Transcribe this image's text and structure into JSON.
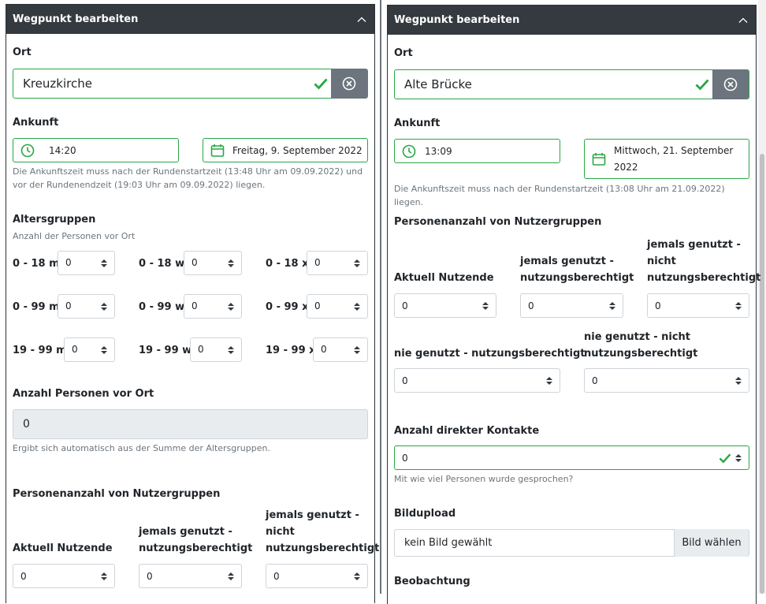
{
  "left": {
    "title": "Wegpunkt bearbeiten",
    "ort": {
      "label": "Ort",
      "value": "Kreuzkirche"
    },
    "ankunft": {
      "label": "Ankunft",
      "time": "14:20",
      "date": "Freitag, 9. September 2022",
      "hint": "Die Ankunftszeit muss nach der Rundenstartzeit (13:48 Uhr am 09.09.2022) und vor der Rundenendzeit (19:03 Uhr am 09.09.2022) liegen."
    },
    "altersgruppen": {
      "label": "Altersgruppen",
      "hint": "Anzahl der Personen vor Ort",
      "groups": [
        {
          "label": "0 - 18 m",
          "value": "0"
        },
        {
          "label": "0 - 18 w",
          "value": "0"
        },
        {
          "label": "0 - 18 x",
          "value": "0"
        },
        {
          "label": "0 - 99 m",
          "value": "0"
        },
        {
          "label": "0 - 99 w",
          "value": "0"
        },
        {
          "label": "0 - 99 x",
          "value": "0"
        },
        {
          "label": "19 - 99 m",
          "value": "0"
        },
        {
          "label": "19 - 99 w",
          "value": "0"
        },
        {
          "label": "19 - 99 x",
          "value": "0"
        }
      ]
    },
    "anzahl_personen": {
      "label": "Anzahl Personen vor Ort",
      "value": "0",
      "hint": "Ergibt sich automatisch aus der Summe der Altersgruppen."
    },
    "nutzergruppen": {
      "label": "Personenanzahl von Nutzergruppen",
      "col1": "Aktuell Nutzende",
      "col2_l1": "jemals genutzt -",
      "col2_l2": "nutzungsberechtigt",
      "col3_l1": "jemals genutzt -",
      "col3_l2": "nicht",
      "col3_l3": "nutzungsberechtigt",
      "v1": "0",
      "v2": "0",
      "v3": "0"
    }
  },
  "right": {
    "title": "Wegpunkt bearbeiten",
    "ort": {
      "label": "Ort",
      "value": "Alte Brücke"
    },
    "ankunft": {
      "label": "Ankunft",
      "time": "13:09",
      "date_l1": "Mittwoch, 21. September",
      "date_l2": "2022",
      "hint": "Die Ankunftszeit muss nach der Rundenstartzeit (13:08 Uhr am 21.09.2022) liegen."
    },
    "nutzergruppen": {
      "label": "Personenanzahl von Nutzergruppen",
      "col1": "Aktuell Nutzende",
      "col2_l1": "jemals genutzt -",
      "col2_l2": "nutzungsberechtigt",
      "col3_l1": "jemals genutzt -",
      "col3_l2": "nicht",
      "col3_l3": "nutzungsberechtigt",
      "col4": "nie genutzt - nutzungsberechtigt",
      "col5_l1": "nie genutzt - nicht",
      "col5_l2": "nutzungsberechtigt",
      "v1": "0",
      "v2": "0",
      "v3": "0",
      "v4": "0",
      "v5": "0"
    },
    "kontakte": {
      "label": "Anzahl direkter Kontakte",
      "value": "0",
      "hint": "Mit wie viel Personen wurde gesprochen?"
    },
    "bildupload": {
      "label": "Bildupload",
      "placeholder": "kein Bild gewählt",
      "button": "Bild wählen"
    },
    "beobachtung": {
      "label": "Beobachtung"
    }
  },
  "colors": {
    "header": "#343a40",
    "valid": "#28a745",
    "secondary": "#6c757d"
  }
}
